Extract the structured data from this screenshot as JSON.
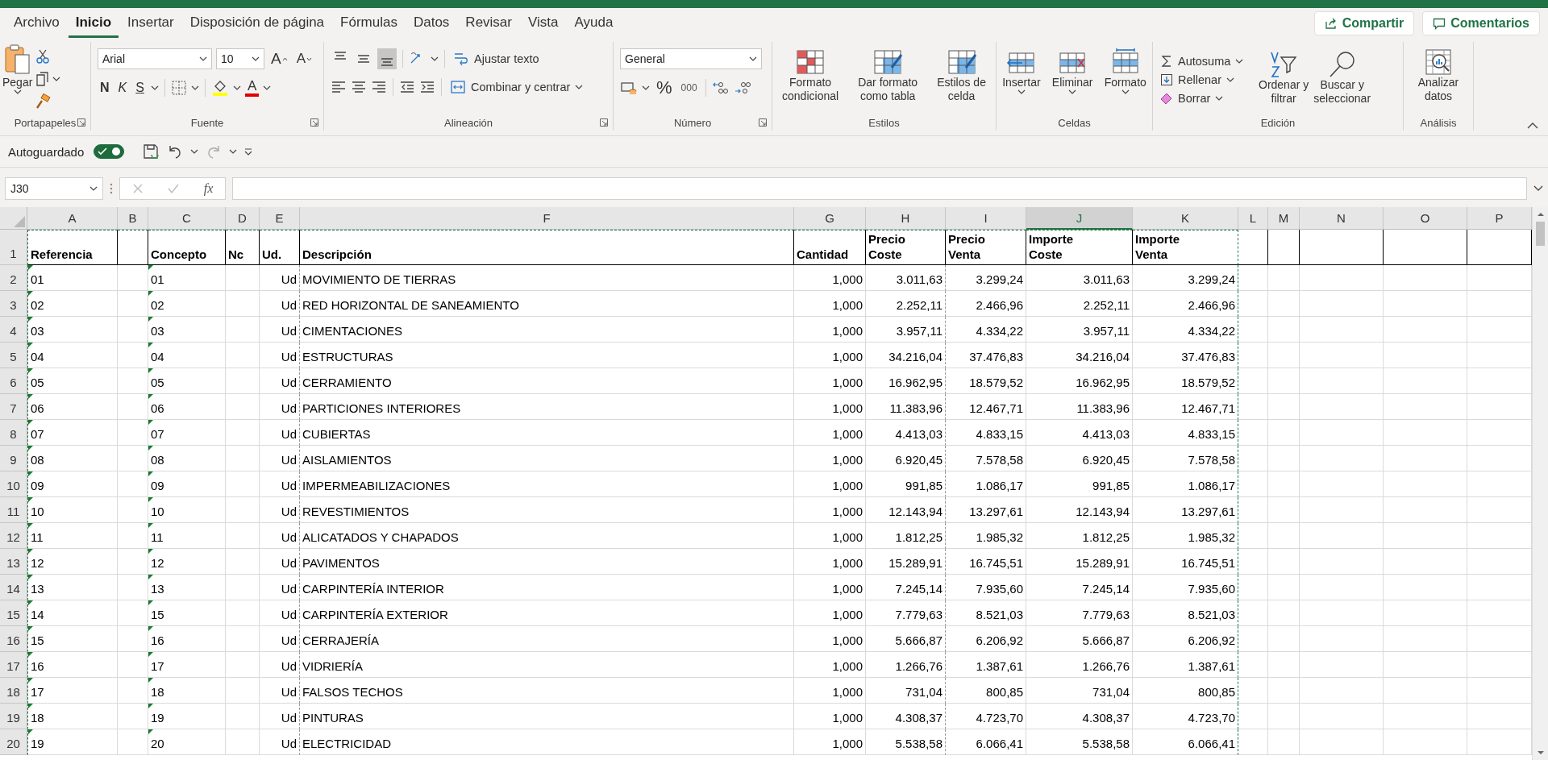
{
  "tabs": [
    {
      "label": "Archivo",
      "selected": false
    },
    {
      "label": "Inicio",
      "selected": true
    },
    {
      "label": "Insertar",
      "selected": false
    },
    {
      "label": "Disposición de página",
      "selected": false
    },
    {
      "label": "Fórmulas",
      "selected": false
    },
    {
      "label": "Datos",
      "selected": false
    },
    {
      "label": "Revisar",
      "selected": false
    },
    {
      "label": "Vista",
      "selected": false
    },
    {
      "label": "Ayuda",
      "selected": false
    }
  ],
  "share_button": "Compartir",
  "comments_button": "Comentarios",
  "ribbon": {
    "clipboard": {
      "label": "Portapapeles",
      "paste": "Pegar"
    },
    "font": {
      "label": "Fuente",
      "font_name": "Arial",
      "font_size": "10",
      "grow_font": "A",
      "shrink_font": "A",
      "bold": "N",
      "italic": "K",
      "underline": "S",
      "font_color": "A"
    },
    "alignment": {
      "label": "Alineación",
      "vertical_align": [
        {
          "selected": false
        },
        {
          "selected": false
        },
        {
          "selected": true
        }
      ],
      "wrap_text": "Ajustar texto",
      "merge": "Combinar y centrar"
    },
    "number": {
      "label": "Número",
      "format": "General",
      "percent": "%",
      "thousands": "000"
    },
    "styles": {
      "label": "Estilos",
      "buttons": [
        {
          "lines": [
            "Formato",
            "condicional"
          ]
        },
        {
          "lines": [
            "Dar formato",
            "como tabla"
          ]
        },
        {
          "lines": [
            "Estilos de",
            "celda"
          ]
        }
      ]
    },
    "cells": {
      "label": "Celdas",
      "buttons": [
        "Insertar",
        "Eliminar",
        "Formato"
      ]
    },
    "editing": {
      "label": "Edición",
      "autosum": "Autosuma",
      "fill": "Rellenar",
      "clear": "Borrar",
      "sort": [
        "Ordenar y",
        "filtrar"
      ],
      "find": [
        "Buscar y",
        "seleccionar"
      ]
    },
    "analysis": {
      "label": "Análisis",
      "analyze": [
        "Analizar",
        "datos"
      ]
    }
  },
  "quick_access": {
    "autosave_label": "Autoguardado",
    "autosave_on": true
  },
  "formula_bar": {
    "name_box": "J30",
    "function_label": "fx"
  },
  "sheet": {
    "header_row_number": "1",
    "columns": [
      {
        "letter": "A",
        "selected": false,
        "header": [
          "Referencia"
        ]
      },
      {
        "letter": "B",
        "selected": false
      },
      {
        "letter": "C",
        "selected": false,
        "header": [
          "Concepto"
        ]
      },
      {
        "letter": "D",
        "selected": false,
        "header": [
          "Nc"
        ]
      },
      {
        "letter": "E",
        "selected": false,
        "header": [
          "Ud."
        ]
      },
      {
        "letter": "F",
        "selected": false,
        "header": [
          "Descripción"
        ]
      },
      {
        "letter": "G",
        "selected": false,
        "header": [
          "Cantidad"
        ]
      },
      {
        "letter": "H",
        "selected": false,
        "header": [
          "Precio",
          "Coste"
        ]
      },
      {
        "letter": "I",
        "selected": false,
        "header": [
          "Precio",
          "Venta"
        ]
      },
      {
        "letter": "J",
        "selected": true,
        "header": [
          "Importe",
          "Coste"
        ]
      },
      {
        "letter": "K",
        "selected": false,
        "header": [
          "Importe",
          "Venta"
        ]
      },
      {
        "letter": "L",
        "selected": false
      },
      {
        "letter": "M",
        "selected": false
      },
      {
        "letter": "N",
        "selected": false
      },
      {
        "letter": "O",
        "selected": false
      },
      {
        "letter": "P",
        "selected": false
      }
    ],
    "rows": [
      {
        "number": "2",
        "ref": "01",
        "concept": "01",
        "unit": "Ud",
        "description": "MOVIMIENTO DE TIERRAS",
        "quantity": "1,000",
        "unit_cost": "3.011,63",
        "unit_price": "3.299,24",
        "total_cost": "3.011,63",
        "total_price": "3.299,24"
      },
      {
        "number": "3",
        "ref": "02",
        "concept": "02",
        "unit": "Ud",
        "description": "RED HORIZONTAL DE SANEAMIENTO",
        "quantity": "1,000",
        "unit_cost": "2.252,11",
        "unit_price": "2.466,96",
        "total_cost": "2.252,11",
        "total_price": "2.466,96"
      },
      {
        "number": "4",
        "ref": "03",
        "concept": "03",
        "unit": "Ud",
        "description": "CIMENTACIONES",
        "quantity": "1,000",
        "unit_cost": "3.957,11",
        "unit_price": "4.334,22",
        "total_cost": "3.957,11",
        "total_price": "4.334,22"
      },
      {
        "number": "5",
        "ref": "04",
        "concept": "04",
        "unit": "Ud",
        "description": "ESTRUCTURAS",
        "quantity": "1,000",
        "unit_cost": "34.216,04",
        "unit_price": "37.476,83",
        "total_cost": "34.216,04",
        "total_price": "37.476,83"
      },
      {
        "number": "6",
        "ref": "05",
        "concept": "05",
        "unit": "Ud",
        "description": "CERRAMIENTO",
        "quantity": "1,000",
        "unit_cost": "16.962,95",
        "unit_price": "18.579,52",
        "total_cost": "16.962,95",
        "total_price": "18.579,52"
      },
      {
        "number": "7",
        "ref": "06",
        "concept": "06",
        "unit": "Ud",
        "description": "PARTICIONES INTERIORES",
        "quantity": "1,000",
        "unit_cost": "11.383,96",
        "unit_price": "12.467,71",
        "total_cost": "11.383,96",
        "total_price": "12.467,71"
      },
      {
        "number": "8",
        "ref": "07",
        "concept": "07",
        "unit": "Ud",
        "description": "CUBIERTAS",
        "quantity": "1,000",
        "unit_cost": "4.413,03",
        "unit_price": "4.833,15",
        "total_cost": "4.413,03",
        "total_price": "4.833,15"
      },
      {
        "number": "9",
        "ref": "08",
        "concept": "08",
        "unit": "Ud",
        "description": "AISLAMIENTOS",
        "quantity": "1,000",
        "unit_cost": "6.920,45",
        "unit_price": "7.578,58",
        "total_cost": "6.920,45",
        "total_price": "7.578,58"
      },
      {
        "number": "10",
        "ref": "09",
        "concept": "09",
        "unit": "Ud",
        "description": "IMPERMEABILIZACIONES",
        "quantity": "1,000",
        "unit_cost": "991,85",
        "unit_price": "1.086,17",
        "total_cost": "991,85",
        "total_price": "1.086,17"
      },
      {
        "number": "11",
        "ref": "10",
        "concept": "10",
        "unit": "Ud",
        "description": "REVESTIMIENTOS",
        "quantity": "1,000",
        "unit_cost": "12.143,94",
        "unit_price": "13.297,61",
        "total_cost": "12.143,94",
        "total_price": "13.297,61"
      },
      {
        "number": "12",
        "ref": "11",
        "concept": "11",
        "unit": "Ud",
        "description": "ALICATADOS Y CHAPADOS",
        "quantity": "1,000",
        "unit_cost": "1.812,25",
        "unit_price": "1.985,32",
        "total_cost": "1.812,25",
        "total_price": "1.985,32"
      },
      {
        "number": "13",
        "ref": "12",
        "concept": "12",
        "unit": "Ud",
        "description": "PAVIMENTOS",
        "quantity": "1,000",
        "unit_cost": "15.289,91",
        "unit_price": "16.745,51",
        "total_cost": "15.289,91",
        "total_price": "16.745,51"
      },
      {
        "number": "14",
        "ref": "13",
        "concept": "13",
        "unit": "Ud",
        "description": "CARPINTERÍA INTERIOR",
        "quantity": "1,000",
        "unit_cost": "7.245,14",
        "unit_price": "7.935,60",
        "total_cost": "7.245,14",
        "total_price": "7.935,60"
      },
      {
        "number": "15",
        "ref": "14",
        "concept": "15",
        "unit": "Ud",
        "description": "CARPINTERÍA EXTERIOR",
        "quantity": "1,000",
        "unit_cost": "7.779,63",
        "unit_price": "8.521,03",
        "total_cost": "7.779,63",
        "total_price": "8.521,03"
      },
      {
        "number": "16",
        "ref": "15",
        "concept": "16",
        "unit": "Ud",
        "description": "CERRAJERÍA",
        "quantity": "1,000",
        "unit_cost": "5.666,87",
        "unit_price": "6.206,92",
        "total_cost": "5.666,87",
        "total_price": "6.206,92"
      },
      {
        "number": "17",
        "ref": "16",
        "concept": "17",
        "unit": "Ud",
        "description": "VIDRIERÍA",
        "quantity": "1,000",
        "unit_cost": "1.266,76",
        "unit_price": "1.387,61",
        "total_cost": "1.266,76",
        "total_price": "1.387,61"
      },
      {
        "number": "18",
        "ref": "17",
        "concept": "18",
        "unit": "Ud",
        "description": "FALSOS TECHOS",
        "quantity": "1,000",
        "unit_cost": "731,04",
        "unit_price": "800,85",
        "total_cost": "731,04",
        "total_price": "800,85"
      },
      {
        "number": "19",
        "ref": "18",
        "concept": "19",
        "unit": "Ud",
        "description": "PINTURAS",
        "quantity": "1,000",
        "unit_cost": "4.308,37",
        "unit_price": "4.723,70",
        "total_cost": "4.308,37",
        "total_price": "4.723,70"
      },
      {
        "number": "20",
        "ref": "19",
        "concept": "20",
        "unit": "Ud",
        "description": "ELECTRICIDAD",
        "quantity": "1,000",
        "unit_cost": "5.538,58",
        "unit_price": "6.066,41",
        "total_cost": "5.538,58",
        "total_price": "6.066,41"
      }
    ]
  }
}
